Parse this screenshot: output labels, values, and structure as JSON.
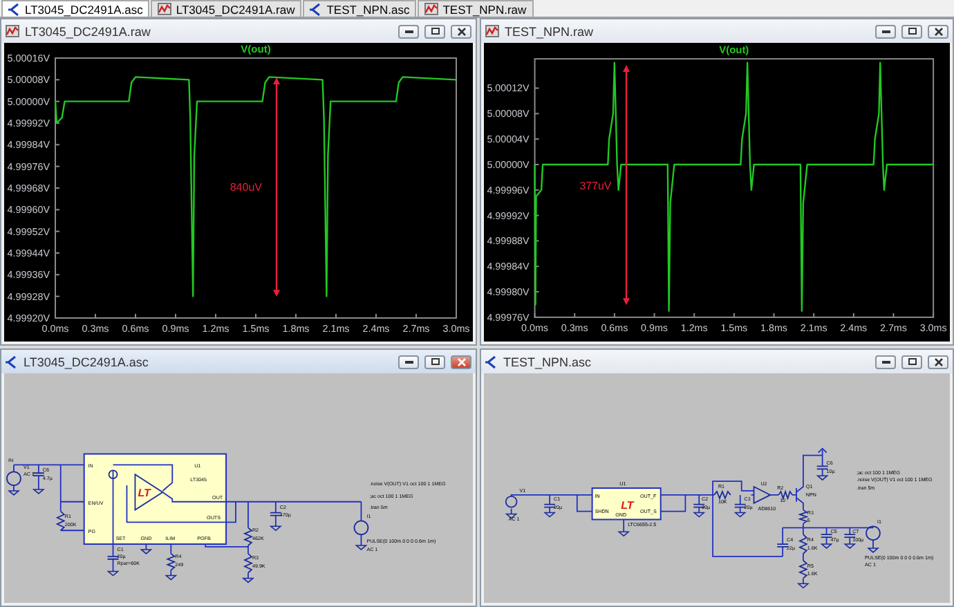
{
  "tabs": [
    {
      "label": "LT3045_DC2491A.asc",
      "kind": "schematic",
      "selected": true
    },
    {
      "label": "LT3045_DC2491A.raw",
      "kind": "waveform",
      "selected": false
    },
    {
      "label": "TEST_NPN.asc",
      "kind": "schematic",
      "selected": false
    },
    {
      "label": "TEST_NPN.raw",
      "kind": "waveform",
      "selected": false
    }
  ],
  "windows": [
    {
      "title": "LT3045_DC2491A.raw",
      "kind": "waveform",
      "active": false,
      "chart_data": {
        "type": "line",
        "xlim": [
          0,
          3
        ],
        "ylim": [
          4.9992,
          5.00016
        ],
        "xticks": [
          {
            "value": 0,
            "label": "0.0ms"
          },
          {
            "value": 0.3,
            "label": "0.3ms"
          },
          {
            "value": 0.6,
            "label": "0.6ms"
          },
          {
            "value": 0.9,
            "label": "0.9ms"
          },
          {
            "value": 1.2,
            "label": "1.2ms"
          },
          {
            "value": 1.5,
            "label": "1.5ms"
          },
          {
            "value": 1.8,
            "label": "1.8ms"
          },
          {
            "value": 2.1,
            "label": "2.1ms"
          },
          {
            "value": 2.4,
            "label": "2.4ms"
          },
          {
            "value": 2.7,
            "label": "2.7ms"
          },
          {
            "value": 3,
            "label": "3.0ms"
          }
        ],
        "yticks": [
          {
            "value": 5.00016,
            "label": "5.00016V"
          },
          {
            "value": 5.00008,
            "label": "5.00008V"
          },
          {
            "value": 5.0,
            "label": "5.00000V"
          },
          {
            "value": 4.99992,
            "label": "4.99992V"
          },
          {
            "value": 4.99984,
            "label": "4.99984V"
          },
          {
            "value": 4.99976,
            "label": "4.99976V"
          },
          {
            "value": 4.99968,
            "label": "4.99968V"
          },
          {
            "value": 4.9996,
            "label": "4.99960V"
          },
          {
            "value": 4.99952,
            "label": "4.99952V"
          },
          {
            "value": 4.99944,
            "label": "4.99944V"
          },
          {
            "value": 4.99936,
            "label": "4.99936V"
          },
          {
            "value": 4.99928,
            "label": "4.99928V"
          },
          {
            "value": 4.9992,
            "label": "4.99920V"
          }
        ],
        "x": [
          0,
          0.01,
          0.05,
          0.07,
          0.55,
          0.57,
          0.6,
          1.0,
          1.01,
          1.03,
          1.04,
          1.06,
          1.55,
          1.57,
          1.6,
          2.0,
          2.01,
          2.03,
          2.04,
          2.06,
          2.55,
          2.57,
          2.6,
          3.0
        ],
        "series": [
          {
            "name": "V(out)",
            "color": "#22c822",
            "values": [
              5.0,
              4.99992,
              4.99994,
              5.0,
              5.0,
              5.00007,
              5.00009,
              5.00008,
              4.99994,
              4.99928,
              4.9998,
              5.0,
              5.0,
              5.00007,
              5.00009,
              5.00008,
              4.99994,
              4.99928,
              4.9998,
              5.0,
              5.0,
              5.00007,
              5.00009,
              5.00008
            ]
          }
        ],
        "annotations": [
          "840uV"
        ]
      }
    },
    {
      "title": "TEST_NPN.raw",
      "kind": "waveform",
      "active": false,
      "chart_data": {
        "type": "line",
        "xlim": [
          0,
          3
        ],
        "ylim": [
          4.99976,
          5.000166
        ],
        "xticks": [
          {
            "value": 0,
            "label": "0.0ms"
          },
          {
            "value": 0.3,
            "label": "0.3ms"
          },
          {
            "value": 0.6,
            "label": "0.6ms"
          },
          {
            "value": 0.9,
            "label": "0.9ms"
          },
          {
            "value": 1.2,
            "label": "1.2ms"
          },
          {
            "value": 1.5,
            "label": "1.5ms"
          },
          {
            "value": 1.8,
            "label": "1.8ms"
          },
          {
            "value": 2.1,
            "label": "2.1ms"
          },
          {
            "value": 2.4,
            "label": "2.4ms"
          },
          {
            "value": 2.7,
            "label": "2.7ms"
          },
          {
            "value": 3,
            "label": "3.0ms"
          }
        ],
        "yticks": [
          {
            "value": 5.00012,
            "label": "5.00012V"
          },
          {
            "value": 5.00008,
            "label": "5.00008V"
          },
          {
            "value": 5.00004,
            "label": "5.00004V"
          },
          {
            "value": 5.0,
            "label": "5.00000V"
          },
          {
            "value": 4.99996,
            "label": "4.99996V"
          },
          {
            "value": 4.99992,
            "label": "4.99992V"
          },
          {
            "value": 4.99988,
            "label": "4.99988V"
          },
          {
            "value": 4.99984,
            "label": "4.99984V"
          },
          {
            "value": 4.9998,
            "label": "4.99980V"
          },
          {
            "value": 4.99976,
            "label": "4.99976V"
          }
        ],
        "x": [
          0,
          0.005,
          0.01,
          0.05,
          0.06,
          0.55,
          0.56,
          0.59,
          0.6,
          0.62,
          0.63,
          0.65,
          1.0,
          1.01,
          1.02,
          1.05,
          1.55,
          1.56,
          1.59,
          1.6,
          1.62,
          1.63,
          1.65,
          2.0,
          2.01,
          2.02,
          2.05,
          2.55,
          2.56,
          2.59,
          2.6,
          2.62,
          2.63,
          2.65,
          3.0
        ],
        "series": [
          {
            "name": "V(out)",
            "color": "#22c822",
            "values": [
              5.0,
              4.99978,
              4.99995,
              4.99996,
              5.0,
              5.0,
              5.00004,
              5.00008,
              5.00016,
              5.0,
              4.99996,
              5.0,
              5.0,
              4.99977,
              4.99994,
              5.0,
              5.0,
              5.00004,
              5.00008,
              5.00016,
              5.0,
              4.99996,
              5.0,
              5.0,
              4.99977,
              4.99994,
              5.0,
              5.0,
              5.00004,
              5.00008,
              5.00016,
              5.0,
              4.99996,
              5.0,
              5.0
            ]
          }
        ],
        "annotations": [
          "377uV"
        ]
      }
    },
    {
      "title": "LT3045_DC2491A.asc",
      "kind": "schematic",
      "active": true,
      "chip_logo": "LT",
      "labels": [
        "IN",
        "V1",
        "AC 1",
        "C6",
        "4.7µ",
        "R1",
        "200K",
        "IN",
        "EN/UV",
        "PG",
        "U1",
        "LT3045",
        "OUT",
        "OUTS",
        "SET",
        "GND",
        "ILIM",
        "PGFB",
        "C1",
        "20µ",
        "Rpar=60K",
        "R4",
        "249",
        "R2",
        "462K",
        "R3",
        "49.9K",
        "C2",
        "470µ",
        ".noise V(OUT) V1 oct 100 1 1MEG",
        ";ac oct 100 1 1MEG",
        ".tran 5m",
        "I1",
        "PULSE(0 100m 0 0 0 0.6m 1m)",
        "AC 1"
      ]
    },
    {
      "title": "TEST_NPN.asc",
      "kind": "schematic",
      "active": false,
      "chip_logo": "LT",
      "labels": [
        "V1",
        "AC 1",
        "C1",
        "20µ",
        "U1",
        "IN",
        "SHDN",
        "OUT_F",
        "OUT_S",
        "GND",
        "LTC6655-2.5",
        "C2",
        "20µ",
        "R1",
        "10K",
        "C3",
        "20µ",
        "U2",
        "AD8610",
        "R2",
        "10",
        "Q1",
        "NPN",
        "C6",
        "10µ",
        ";ac oct 100 1 1MEG",
        ".noise V(OUT) V1 oct 100 1 1MEG",
        ".tran 5m",
        "R3",
        "5",
        "R4",
        "1.6K",
        "R5",
        "1.6K",
        "C4",
        "22µ",
        "C5",
        "47µ",
        "C7",
        "100µ",
        "I1",
        "PULSE(0 100m 0 0 0 0.6m 1m)",
        "AC 1"
      ]
    }
  ]
}
